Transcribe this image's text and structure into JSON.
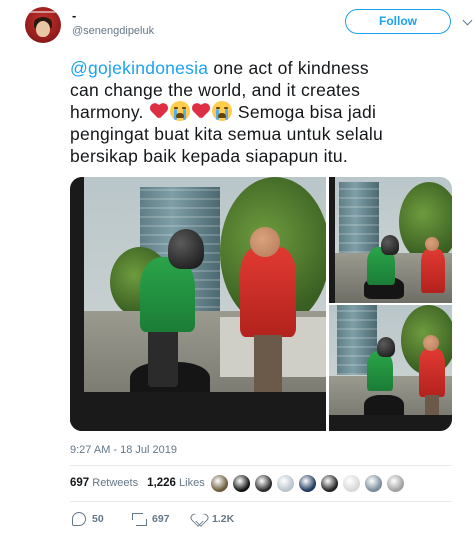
{
  "user": {
    "display_name": "-",
    "handle": "@senengdipeluk",
    "avatar_icon": "profile-avatar"
  },
  "follow_button": {
    "label": "Follow",
    "color": "#1da1f2"
  },
  "more_menu_icon": "chevron-down-icon",
  "tweet": {
    "mention": "@gojekindonesia",
    "line1_rest": " one act of kindness",
    "line2": "can change the world, and it creates",
    "line3_start": "harmony.",
    "emojis": [
      "red-heart",
      "loudly-crying-face",
      "red-heart",
      "loudly-crying-face"
    ],
    "line3_rest": " Semoga bisa jadi",
    "line4": "pengingat buat kita semua untuk selalu",
    "line5": "bersikap baik kepada siapapun itu."
  },
  "media": {
    "photos": [
      "photo-main",
      "photo-top-right",
      "photo-bottom-right"
    ]
  },
  "timestamp": "9:27 AM - 18 Jul 2019",
  "stats": {
    "retweets_count": "697",
    "retweets_label": "Retweets",
    "likes_count": "1,226",
    "likes_label": "Likes"
  },
  "likers": {
    "count": 9,
    "colors": [
      "#6a5a3a",
      "#111111",
      "#2b2b2b",
      "#b9c4cc",
      "#1f3a5f",
      "#222222",
      "#d8d8d8",
      "#7a8a9a",
      "#a0a0a0"
    ]
  },
  "actions": {
    "reply_count": "50",
    "retweet_count": "697",
    "like_count": "1.2K"
  },
  "colors": {
    "accent": "#1da1f2",
    "secondary_text": "#657786",
    "primary_text": "#14171a"
  }
}
